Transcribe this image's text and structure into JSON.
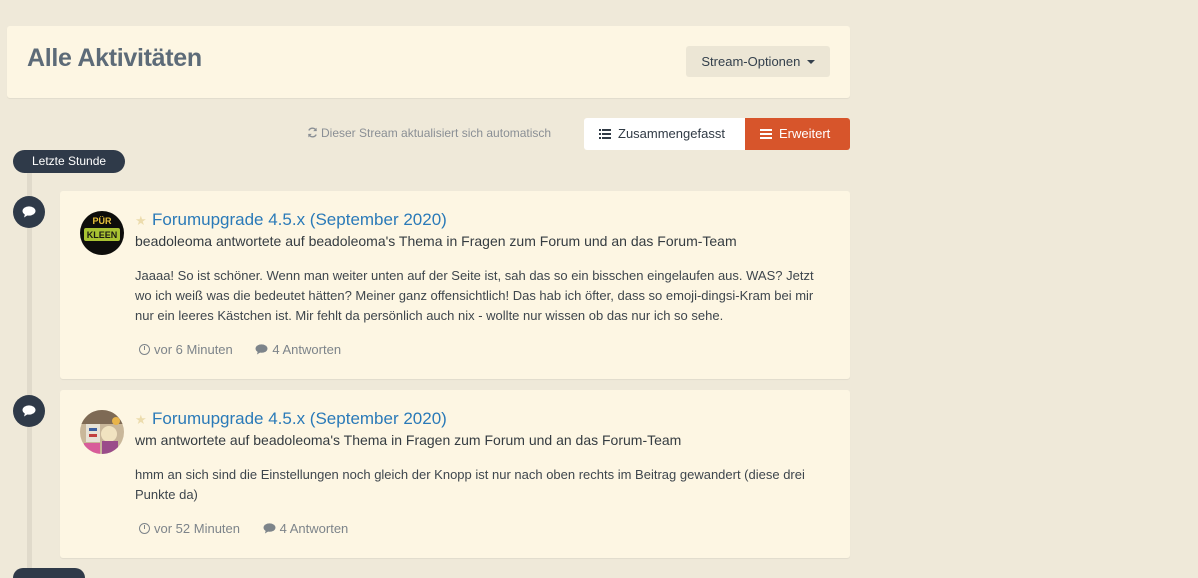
{
  "header": {
    "title": "Alle Aktivitäten",
    "stream_options_label": "Stream-Optionen"
  },
  "toolbar": {
    "auto_update_text": "Dieser Stream aktualisiert sich automatisch",
    "view_compact_label": "Zusammengefasst",
    "view_expanded_label": "Erweitert"
  },
  "timeline": {
    "section_label": "Letzte Stunde"
  },
  "colors": {
    "accent": "#d7552b",
    "link": "#2a7ab8",
    "dark": "#2f3a49",
    "background": "#efe9d9",
    "card": "#fdf6e3"
  },
  "posts": [
    {
      "title": "Forumupgrade 4.5.x (September 2020)",
      "meta": "beadoleoma antwortete auf beadoleoma's Thema in Fragen zum Forum und an das Forum-Team",
      "body": "Jaaaa! So ist schöner. Wenn man weiter unten auf der Seite ist, sah das so ein bisschen eingelaufen aus. WAS? Jetzt wo ich weiß was die bedeutet hätten? Meiner ganz offensichtlich! Das hab ich öfter, dass so emoji-dingsi-Kram bei mir nur ein leeres Kästchen ist. Mir fehlt da persönlich auch nix - wollte nur wissen ob das nur ich so sehe.",
      "time": "vor 6 Minuten",
      "replies": "4 Antworten",
      "avatar_text_top": "PÜR",
      "avatar_text_bottom": "KLEEN",
      "avatar_icon": "avatar-logo-icon"
    },
    {
      "title": "Forumupgrade 4.5.x (September 2020)",
      "meta": "wm antwortete auf beadoleoma's Thema in Fragen zum Forum und an das Forum-Team",
      "body": "hmm an sich sind die Einstellungen noch gleich der Knopp ist nur nach oben rechts im Beitrag gewandert (diese drei Punkte da)",
      "time": "vor 52 Minuten",
      "replies": "4 Antworten",
      "avatar_icon": "avatar-illustration-icon"
    }
  ]
}
